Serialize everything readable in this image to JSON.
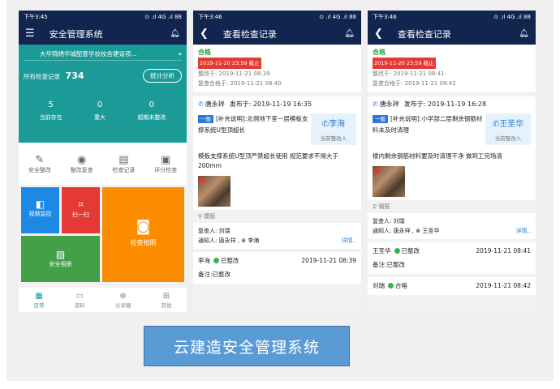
{
  "phone1": {
    "time": "下午3:45",
    "status_icons": "⊙ .ıl 4G .ıl 88",
    "title": "安全管理系统",
    "project": "大华锦绣华城配套学校校舍建设项...",
    "all_records_label": "所有检查记录",
    "all_records_count": "734",
    "stats_button": "统计分析",
    "counts": [
      {
        "n": "5",
        "label": "当前存在"
      },
      {
        "n": "0",
        "label": "重大"
      },
      {
        "n": "0",
        "label": "超期未整改"
      }
    ],
    "menu": [
      {
        "label": "安全整改"
      },
      {
        "label": "整改复查"
      },
      {
        "label": "检查记录"
      },
      {
        "label": "评分检查"
      }
    ],
    "tiles": {
      "video": "视频监控",
      "scan": "扫一扫",
      "photo_check": "检查拍照",
      "album": "安全相册"
    },
    "nav": [
      {
        "label": "日常"
      },
      {
        "label": "资料"
      },
      {
        "label": "分享圈"
      },
      {
        "label": "其他"
      }
    ]
  },
  "phone2": {
    "time": "下午3:46",
    "status_icons": "⊙ .ıl 4G .ıl 88",
    "title": "查看检查记录",
    "status": "合格",
    "deadline": "2019-11-20 23:59 截止",
    "rectify_at": "整改于: 2019-11-21 08:39",
    "pass_at": "复查合格于: 2019-11-21 08:40",
    "author": "唐永祥",
    "published": "发布于: 2019-11-19 16:35",
    "tag": "一般",
    "desc": "[补充说明]:北侧地下室一层模板支撑系统U型顶超长",
    "assignee": "李海",
    "assignee_label": "当前整改人",
    "body": "模板支撑系统U型顶严禁超长使用 规范要求不得大于200mm",
    "category": "模板",
    "reviewer": "复查人: 刘瑞",
    "notify": "通知人: 唐永祥 , ⊗ 李海",
    "detail": "详情..",
    "log": [
      {
        "name": "李海",
        "state": "已整改",
        "time": "2019-11-21 08:39",
        "note": "备注:已整改"
      }
    ]
  },
  "phone3": {
    "time": "下午3:46",
    "status_icons": "⊙ .ıl 4G .ıl 88",
    "title": "查看检查记录",
    "status": "合格",
    "deadline": "2019-11-20 23:59 截止",
    "rectify_at": "整改于: 2019-11-21 08:41",
    "pass_at": "复查合格于: 2019-11-21 08:42",
    "author": "唐永祥",
    "published": "发布于: 2019-11-19 16:28",
    "tag": "一般",
    "desc": "[补充说明]:小学部二层剩余钢筋材料未及时清理",
    "assignee": "王圣华",
    "assignee_label": "当前整改人",
    "body": "楼内剩余钢筋材料要及时清理干净 做到工完场清",
    "category": "钢筋",
    "reviewer": "复查人: 刘瑞",
    "notify": "通知人: 唐永祥 , ⊗ 王圣华",
    "detail": "详情..",
    "log": [
      {
        "name": "王圣华",
        "state": "已整改",
        "time": "2019-11-21 08:41",
        "note": "备注:已整改"
      },
      {
        "name": "刘瑞",
        "state": "合格",
        "time": "2019-11-21 08:42"
      }
    ]
  },
  "caption": "云建造安全管理系统",
  "colors": {
    "header": "#12254f",
    "teal": "#1a9b98",
    "blue": "#1e88e5",
    "red": "#e53935",
    "green": "#43a047",
    "orange": "#fb8c00"
  }
}
